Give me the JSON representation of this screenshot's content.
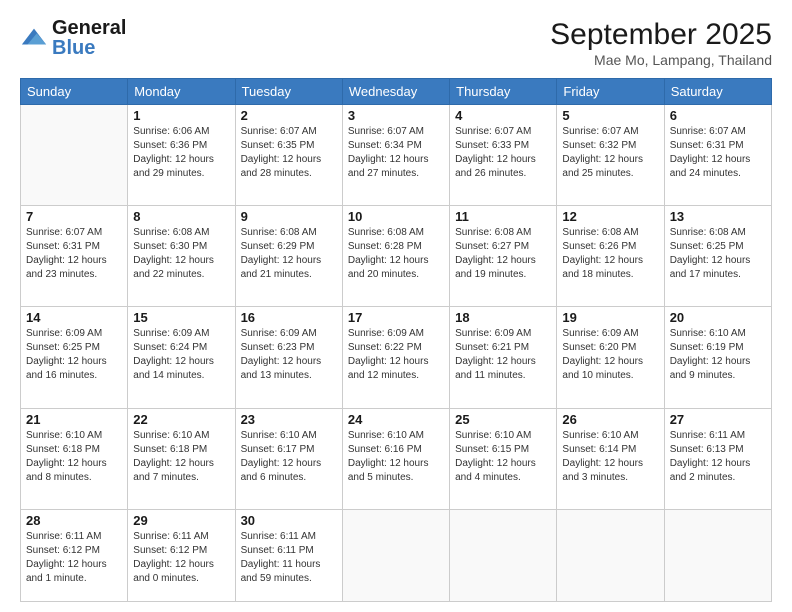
{
  "header": {
    "logo_line1": "General",
    "logo_line2": "Blue",
    "month": "September 2025",
    "location": "Mae Mo, Lampang, Thailand"
  },
  "days_of_week": [
    "Sunday",
    "Monday",
    "Tuesday",
    "Wednesday",
    "Thursday",
    "Friday",
    "Saturday"
  ],
  "weeks": [
    [
      {
        "day": "",
        "info": ""
      },
      {
        "day": "1",
        "info": "Sunrise: 6:06 AM\nSunset: 6:36 PM\nDaylight: 12 hours\nand 29 minutes."
      },
      {
        "day": "2",
        "info": "Sunrise: 6:07 AM\nSunset: 6:35 PM\nDaylight: 12 hours\nand 28 minutes."
      },
      {
        "day": "3",
        "info": "Sunrise: 6:07 AM\nSunset: 6:34 PM\nDaylight: 12 hours\nand 27 minutes."
      },
      {
        "day": "4",
        "info": "Sunrise: 6:07 AM\nSunset: 6:33 PM\nDaylight: 12 hours\nand 26 minutes."
      },
      {
        "day": "5",
        "info": "Sunrise: 6:07 AM\nSunset: 6:32 PM\nDaylight: 12 hours\nand 25 minutes."
      },
      {
        "day": "6",
        "info": "Sunrise: 6:07 AM\nSunset: 6:31 PM\nDaylight: 12 hours\nand 24 minutes."
      }
    ],
    [
      {
        "day": "7",
        "info": "Sunrise: 6:07 AM\nSunset: 6:31 PM\nDaylight: 12 hours\nand 23 minutes."
      },
      {
        "day": "8",
        "info": "Sunrise: 6:08 AM\nSunset: 6:30 PM\nDaylight: 12 hours\nand 22 minutes."
      },
      {
        "day": "9",
        "info": "Sunrise: 6:08 AM\nSunset: 6:29 PM\nDaylight: 12 hours\nand 21 minutes."
      },
      {
        "day": "10",
        "info": "Sunrise: 6:08 AM\nSunset: 6:28 PM\nDaylight: 12 hours\nand 20 minutes."
      },
      {
        "day": "11",
        "info": "Sunrise: 6:08 AM\nSunset: 6:27 PM\nDaylight: 12 hours\nand 19 minutes."
      },
      {
        "day": "12",
        "info": "Sunrise: 6:08 AM\nSunset: 6:26 PM\nDaylight: 12 hours\nand 18 minutes."
      },
      {
        "day": "13",
        "info": "Sunrise: 6:08 AM\nSunset: 6:25 PM\nDaylight: 12 hours\nand 17 minutes."
      }
    ],
    [
      {
        "day": "14",
        "info": "Sunrise: 6:09 AM\nSunset: 6:25 PM\nDaylight: 12 hours\nand 16 minutes."
      },
      {
        "day": "15",
        "info": "Sunrise: 6:09 AM\nSunset: 6:24 PM\nDaylight: 12 hours\nand 14 minutes."
      },
      {
        "day": "16",
        "info": "Sunrise: 6:09 AM\nSunset: 6:23 PM\nDaylight: 12 hours\nand 13 minutes."
      },
      {
        "day": "17",
        "info": "Sunrise: 6:09 AM\nSunset: 6:22 PM\nDaylight: 12 hours\nand 12 minutes."
      },
      {
        "day": "18",
        "info": "Sunrise: 6:09 AM\nSunset: 6:21 PM\nDaylight: 12 hours\nand 11 minutes."
      },
      {
        "day": "19",
        "info": "Sunrise: 6:09 AM\nSunset: 6:20 PM\nDaylight: 12 hours\nand 10 minutes."
      },
      {
        "day": "20",
        "info": "Sunrise: 6:10 AM\nSunset: 6:19 PM\nDaylight: 12 hours\nand 9 minutes."
      }
    ],
    [
      {
        "day": "21",
        "info": "Sunrise: 6:10 AM\nSunset: 6:18 PM\nDaylight: 12 hours\nand 8 minutes."
      },
      {
        "day": "22",
        "info": "Sunrise: 6:10 AM\nSunset: 6:18 PM\nDaylight: 12 hours\nand 7 minutes."
      },
      {
        "day": "23",
        "info": "Sunrise: 6:10 AM\nSunset: 6:17 PM\nDaylight: 12 hours\nand 6 minutes."
      },
      {
        "day": "24",
        "info": "Sunrise: 6:10 AM\nSunset: 6:16 PM\nDaylight: 12 hours\nand 5 minutes."
      },
      {
        "day": "25",
        "info": "Sunrise: 6:10 AM\nSunset: 6:15 PM\nDaylight: 12 hours\nand 4 minutes."
      },
      {
        "day": "26",
        "info": "Sunrise: 6:10 AM\nSunset: 6:14 PM\nDaylight: 12 hours\nand 3 minutes."
      },
      {
        "day": "27",
        "info": "Sunrise: 6:11 AM\nSunset: 6:13 PM\nDaylight: 12 hours\nand 2 minutes."
      }
    ],
    [
      {
        "day": "28",
        "info": "Sunrise: 6:11 AM\nSunset: 6:12 PM\nDaylight: 12 hours\nand 1 minute."
      },
      {
        "day": "29",
        "info": "Sunrise: 6:11 AM\nSunset: 6:12 PM\nDaylight: 12 hours\nand 0 minutes."
      },
      {
        "day": "30",
        "info": "Sunrise: 6:11 AM\nSunset: 6:11 PM\nDaylight: 11 hours\nand 59 minutes."
      },
      {
        "day": "",
        "info": ""
      },
      {
        "day": "",
        "info": ""
      },
      {
        "day": "",
        "info": ""
      },
      {
        "day": "",
        "info": ""
      }
    ]
  ]
}
